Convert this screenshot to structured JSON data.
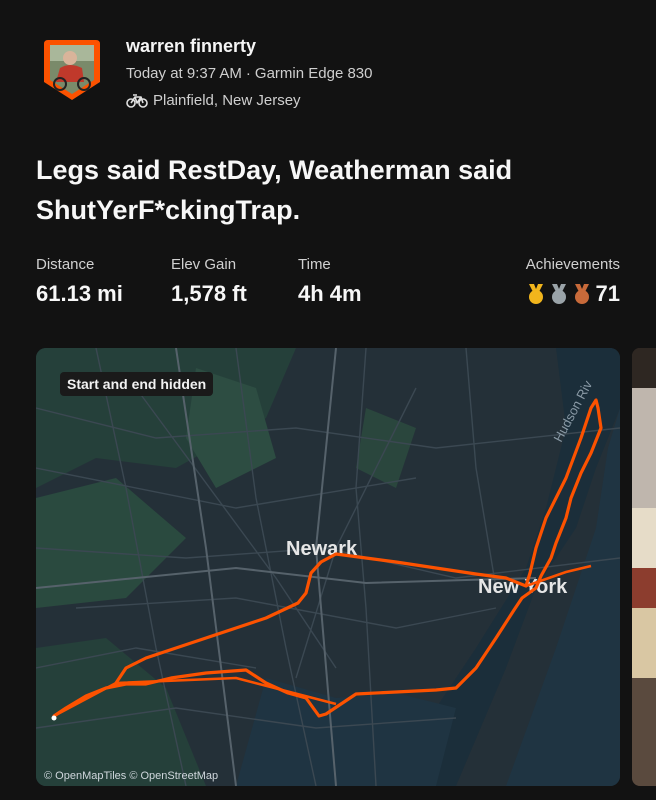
{
  "athlete": {
    "name": "warren finnerty",
    "time": "Today at 9:37 AM",
    "separator": "·",
    "device": "Garmin Edge 830",
    "location": "Plainfield, New Jersey"
  },
  "activity": {
    "title": "Legs said RestDay, Weatherman said ShutYerF*ckingTrap."
  },
  "stats": [
    {
      "label": "Distance",
      "value": "61.13 mi"
    },
    {
      "label": "Elev Gain",
      "value": "1,578 ft"
    },
    {
      "label": "Time",
      "value": "4h 4m"
    }
  ],
  "achievements": {
    "label": "Achievements",
    "count": "71",
    "medals": [
      {
        "icon": "gold-medal-icon",
        "color": "#f1b51c"
      },
      {
        "icon": "silver-medal-icon",
        "color": "#9aa3a8"
      },
      {
        "icon": "bronze-medal-icon",
        "color": "#c86a3a"
      }
    ]
  },
  "map": {
    "badge": "Start and end hidden",
    "labels": {
      "newark": "Newark",
      "new_york": "New York",
      "river": "Hudson Riv"
    },
    "attribution": "© OpenMapTiles © OpenStreetMap",
    "route_color": "#fc5200"
  }
}
